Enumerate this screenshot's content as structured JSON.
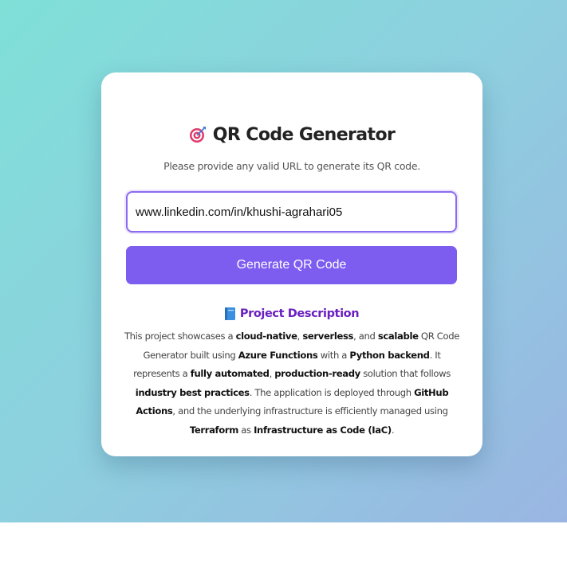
{
  "app": {
    "title": "QR Code Generator",
    "subtitle": "Please provide any valid URL to generate its QR code."
  },
  "form": {
    "url_value": "www.linkedin.com/in/khushi-agrahari05",
    "button_label": "Generate QR Code"
  },
  "description": {
    "heading": "Project Description",
    "parts": [
      {
        "text": "This project showcases a ",
        "bold": false
      },
      {
        "text": "cloud-native",
        "bold": true
      },
      {
        "text": ", ",
        "bold": false
      },
      {
        "text": "serverless",
        "bold": true
      },
      {
        "text": ", and ",
        "bold": false
      },
      {
        "text": "scalable",
        "bold": true
      },
      {
        "text": " QR Code Generator built using ",
        "bold": false
      },
      {
        "text": "Azure Functions",
        "bold": true
      },
      {
        "text": " with a ",
        "bold": false
      },
      {
        "text": "Python backend",
        "bold": true
      },
      {
        "text": ". It represents a ",
        "bold": false
      },
      {
        "text": "fully automated",
        "bold": true
      },
      {
        "text": ", ",
        "bold": false
      },
      {
        "text": "production-ready",
        "bold": true
      },
      {
        "text": " solution that follows ",
        "bold": false
      },
      {
        "text": "industry best practices",
        "bold": true
      },
      {
        "text": ". The application is deployed through ",
        "bold": false
      },
      {
        "text": "GitHub Actions",
        "bold": true
      },
      {
        "text": ", and the underlying infrastructure is efficiently managed using ",
        "bold": false
      },
      {
        "text": "Terraform",
        "bold": true
      },
      {
        "text": " as ",
        "bold": false
      },
      {
        "text": "Infrastructure as Code (IaC)",
        "bold": true
      },
      {
        "text": ".",
        "bold": false
      }
    ]
  },
  "icons": {
    "title_icon": "target-icon",
    "heading_icon": "book-icon"
  },
  "colors": {
    "accent": "#7d5cf0",
    "heading": "#6a1fbf",
    "background_start": "#7fe0d8",
    "background_end": "#9ab5e2"
  }
}
